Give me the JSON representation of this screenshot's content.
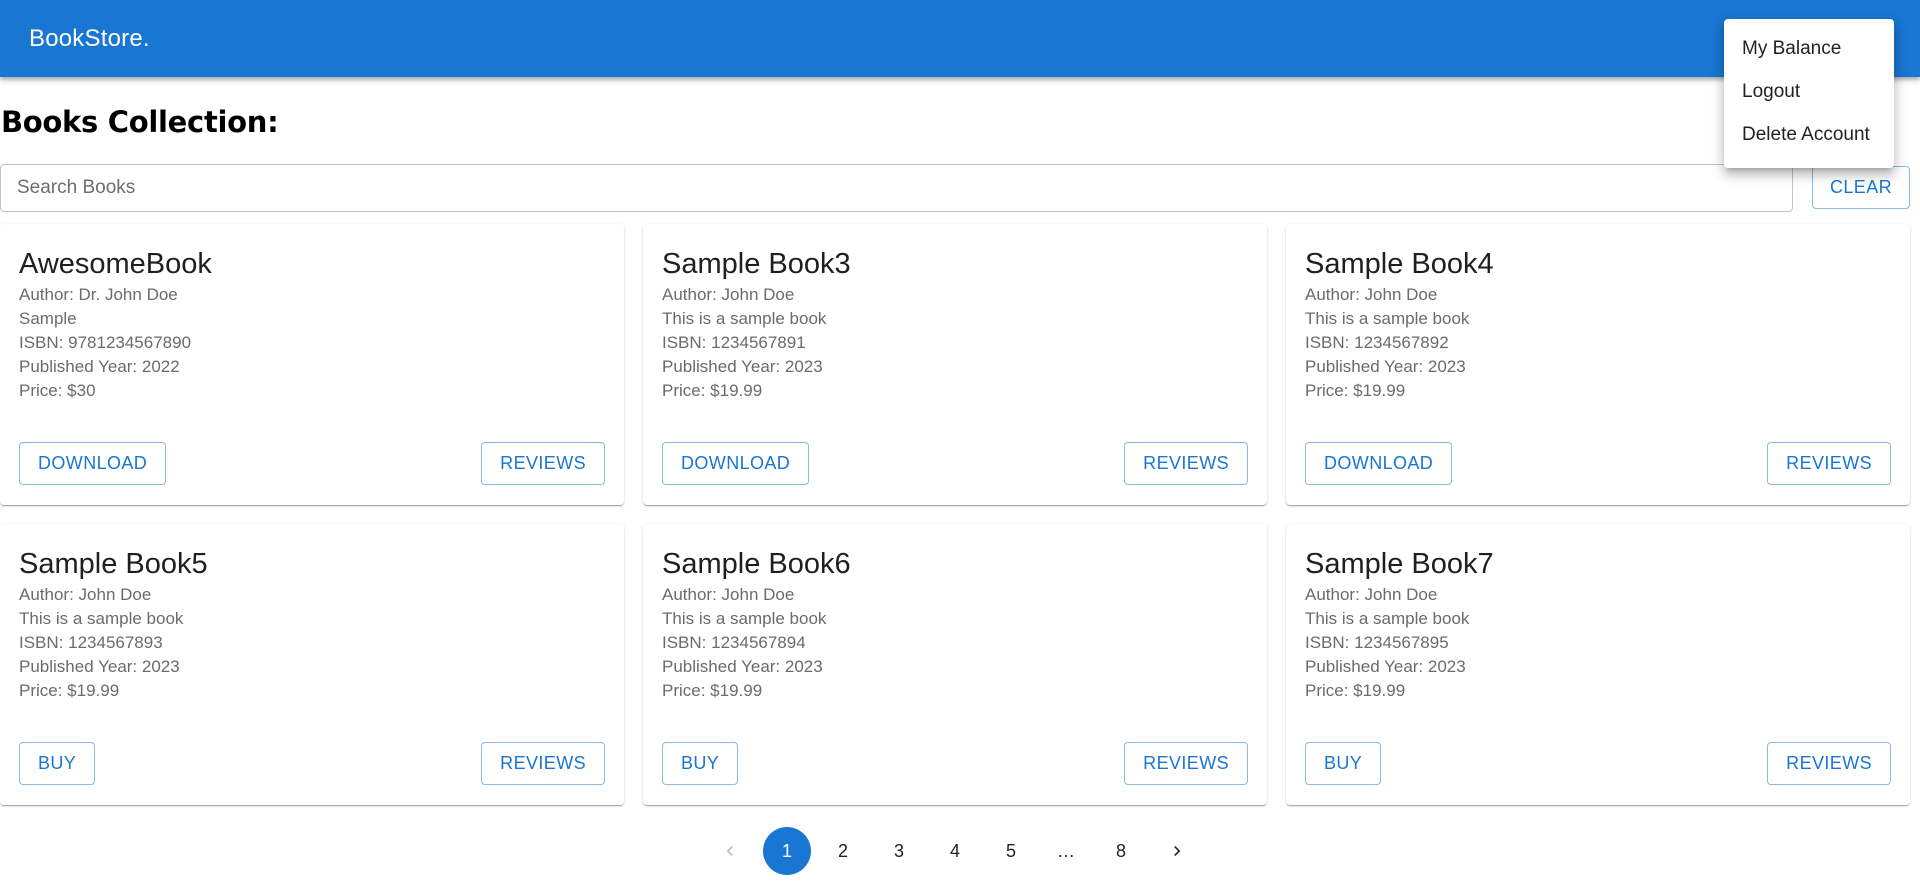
{
  "header": {
    "brand": "BookStore."
  },
  "page": {
    "title": "Books Collection:"
  },
  "search": {
    "placeholder": "Search Books",
    "value": "",
    "clear_label": "CLEAR"
  },
  "books": [
    {
      "title": "AwesomeBook",
      "author": "Author: Dr. John Doe",
      "description": "Sample",
      "isbn": "ISBN: 9781234567890",
      "year": "Published Year: 2022",
      "price": "Price: $30",
      "action_label": "DOWNLOAD",
      "reviews_label": "REVIEWS"
    },
    {
      "title": "Sample Book3",
      "author": "Author: John Doe",
      "description": "This is a sample book",
      "isbn": "ISBN: 1234567891",
      "year": "Published Year: 2023",
      "price": "Price: $19.99",
      "action_label": "DOWNLOAD",
      "reviews_label": "REVIEWS"
    },
    {
      "title": "Sample Book4",
      "author": "Author: John Doe",
      "description": "This is a sample book",
      "isbn": "ISBN: 1234567892",
      "year": "Published Year: 2023",
      "price": "Price: $19.99",
      "action_label": "DOWNLOAD",
      "reviews_label": "REVIEWS"
    },
    {
      "title": "Sample Book5",
      "author": "Author: John Doe",
      "description": "This is a sample book",
      "isbn": "ISBN: 1234567893",
      "year": "Published Year: 2023",
      "price": "Price: $19.99",
      "action_label": "BUY",
      "reviews_label": "REVIEWS"
    },
    {
      "title": "Sample Book6",
      "author": "Author: John Doe",
      "description": "This is a sample book",
      "isbn": "ISBN: 1234567894",
      "year": "Published Year: 2023",
      "price": "Price: $19.99",
      "action_label": "BUY",
      "reviews_label": "REVIEWS"
    },
    {
      "title": "Sample Book7",
      "author": "Author: John Doe",
      "description": "This is a sample book",
      "isbn": "ISBN: 1234567895",
      "year": "Published Year: 2023",
      "price": "Price: $19.99",
      "action_label": "BUY",
      "reviews_label": "REVIEWS"
    }
  ],
  "pagination": {
    "prev_icon": "chevron-left-icon",
    "next_icon": "chevron-right-icon",
    "pages": [
      "1",
      "2",
      "3",
      "4",
      "5"
    ],
    "ellipsis": "…",
    "last_page": "8",
    "current_page": "1"
  },
  "account_menu": {
    "items": [
      "My Balance",
      "Logout",
      "Delete Account"
    ]
  },
  "colors": {
    "primary": "#1976d2",
    "header_text": "#ffffff"
  }
}
